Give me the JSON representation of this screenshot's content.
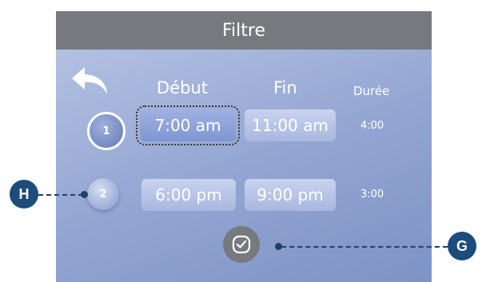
{
  "screen": {
    "title": "Filtre",
    "headers": {
      "start": "Début",
      "end": "Fin",
      "duration": "Durée"
    },
    "cycles": [
      {
        "number": "1",
        "start": "7:00 am",
        "end": "11:00 am",
        "duration": "4:00"
      },
      {
        "number": "2",
        "start": "6:00 pm",
        "end": "9:00 pm",
        "duration": "3:00"
      }
    ]
  },
  "callouts": {
    "h": "H",
    "g": "G"
  },
  "colors": {
    "title_bar": "#767a7f",
    "callout": "#1c4b7c"
  }
}
